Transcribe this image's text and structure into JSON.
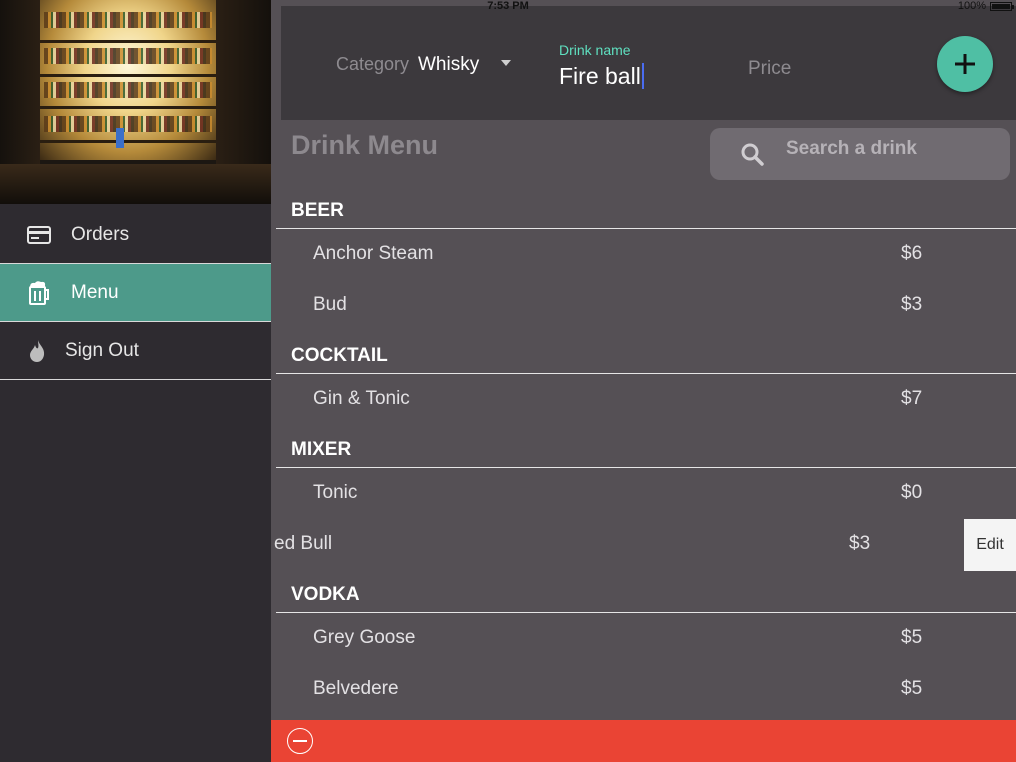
{
  "status_bar": {
    "time": "7:53 PM",
    "battery": "100%"
  },
  "sidebar": {
    "items": [
      {
        "label": "Orders",
        "icon": "credit-card-icon",
        "active": false
      },
      {
        "label": "Menu",
        "icon": "beer-mug-icon",
        "active": true
      },
      {
        "label": "Sign Out",
        "icon": "flame-icon",
        "active": false
      }
    ]
  },
  "form": {
    "category_label": "Category",
    "category_value": "Whisky",
    "drink_name_label": "Drink name",
    "drink_name_value": "Fire ball",
    "price_placeholder": "Price",
    "add_icon": "plus-icon"
  },
  "menu": {
    "title": "Drink Menu",
    "search_placeholder": "Search a drink",
    "sections": [
      {
        "name": "BEER",
        "items": [
          {
            "name": "Anchor Steam",
            "price": "$6"
          },
          {
            "name": "Bud",
            "price": "$3"
          }
        ]
      },
      {
        "name": "COCKTAIL",
        "items": [
          {
            "name": "Gin & Tonic",
            "price": "$7"
          }
        ]
      },
      {
        "name": "MIXER",
        "items": [
          {
            "name": "Tonic",
            "price": "$0"
          },
          {
            "name": "ed Bull",
            "price": "$3",
            "action": "Edit"
          }
        ]
      },
      {
        "name": "VODKA",
        "items": [
          {
            "name": "Grey Goose",
            "price": "$5"
          },
          {
            "name": "Belvedere",
            "price": "$5"
          }
        ]
      }
    ]
  },
  "colors": {
    "accent": "#4fbfa4",
    "active_nav": "#4d9a8a",
    "footer": "#ea4434",
    "label_green": "#5fe0c0"
  }
}
